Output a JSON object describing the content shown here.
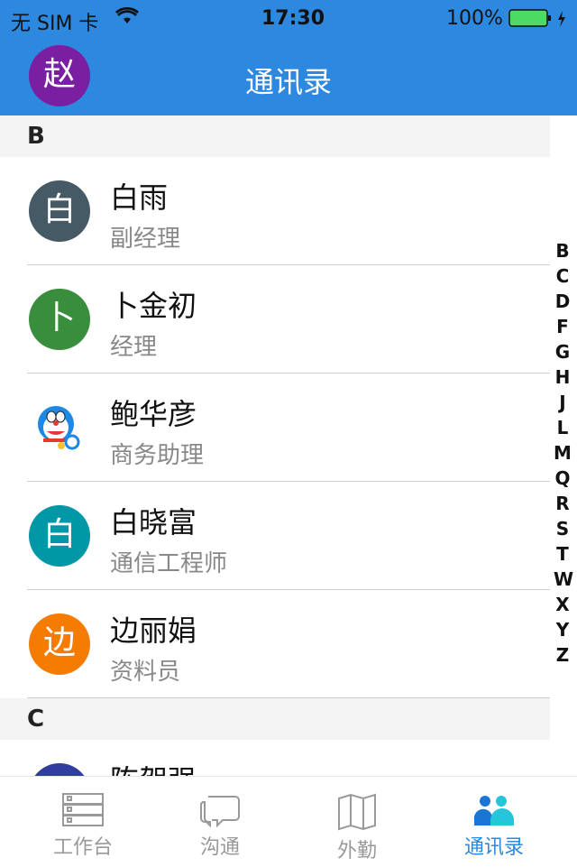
{
  "status": {
    "carrier": "无 SIM 卡",
    "time": "17:30",
    "battery": "100%"
  },
  "nav": {
    "avatar": "赵",
    "avatar_color": "#7b1fa2",
    "title": "通讯录"
  },
  "sections": [
    {
      "letter": "B",
      "contacts": [
        {
          "avatar": "白",
          "color": "#455a64",
          "name": "白雨",
          "title": "副经理"
        },
        {
          "avatar": "卜",
          "color": "#388e3c",
          "name": "卜金初",
          "title": "经理"
        },
        {
          "avatar": "doraemon",
          "color": "#ffffff",
          "name": "鲍华彦",
          "title": "商务助理"
        },
        {
          "avatar": "白",
          "color": "#0097a7",
          "name": "白晓富",
          "title": "通信工程师"
        },
        {
          "avatar": "边",
          "color": "#f57c00",
          "name": "边丽娟",
          "title": "资料员"
        }
      ]
    },
    {
      "letter": "C",
      "contacts": [
        {
          "avatar": "",
          "color": "#303f9f",
          "name": "陈贺强",
          "title": ""
        }
      ]
    }
  ],
  "index": [
    "B",
    "C",
    "D",
    "F",
    "G",
    "H",
    "J",
    "L",
    "M",
    "Q",
    "R",
    "S",
    "T",
    "W",
    "X",
    "Y",
    "Z"
  ],
  "tabs": [
    {
      "label": "工作台",
      "icon": "server-stack-icon"
    },
    {
      "label": "沟通",
      "icon": "chat-bubbles-icon"
    },
    {
      "label": "外勤",
      "icon": "map-icon"
    },
    {
      "label": "通讯录",
      "icon": "contacts-icon",
      "active": true
    }
  ],
  "colors": {
    "primary": "#2d88e0",
    "battery": "#4cd964"
  }
}
